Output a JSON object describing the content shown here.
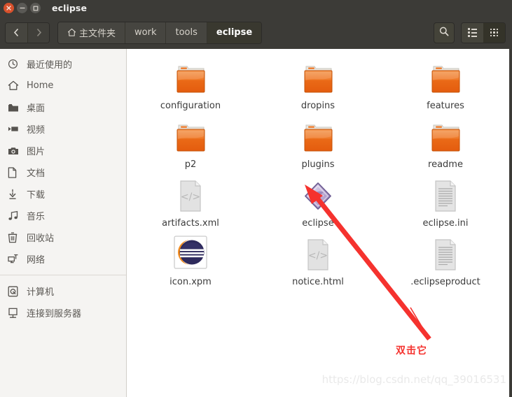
{
  "window": {
    "title": "eclipse",
    "controls": {
      "close": "close-button",
      "minimize": "minimize-button",
      "maximize": "maximize-button"
    }
  },
  "toolbar": {
    "back_label": "‹",
    "forward_label": "›",
    "search_label": "search-icon",
    "view_list_label": "list-view",
    "view_grid_label": "grid-view",
    "breadcrumbs": [
      {
        "label": "主文件夹",
        "icon": "home-icon",
        "active": false
      },
      {
        "label": "work",
        "icon": "",
        "active": false
      },
      {
        "label": "tools",
        "icon": "",
        "active": false
      },
      {
        "label": "eclipse",
        "icon": "",
        "active": true
      }
    ]
  },
  "sidebar": {
    "items": [
      {
        "label": "最近使用的",
        "icon": "clock-icon"
      },
      {
        "label": "Home",
        "icon": "home-icon"
      },
      {
        "label": "桌面",
        "icon": "folder-icon"
      },
      {
        "label": "视频",
        "icon": "video-icon"
      },
      {
        "label": "图片",
        "icon": "camera-icon"
      },
      {
        "label": "文档",
        "icon": "document-icon"
      },
      {
        "label": "下载",
        "icon": "download-icon"
      },
      {
        "label": "音乐",
        "icon": "music-icon"
      },
      {
        "label": "回收站",
        "icon": "trash-icon"
      },
      {
        "label": "网络",
        "icon": "network-icon"
      }
    ],
    "items_lower": [
      {
        "label": "计算机",
        "icon": "computer-icon"
      },
      {
        "label": "连接到服务器",
        "icon": "server-icon"
      }
    ]
  },
  "files": [
    {
      "name": "configuration",
      "type": "folder"
    },
    {
      "name": "dropins",
      "type": "folder"
    },
    {
      "name": "features",
      "type": "folder"
    },
    {
      "name": "p2",
      "type": "folder"
    },
    {
      "name": "plugins",
      "type": "folder"
    },
    {
      "name": "readme",
      "type": "folder"
    },
    {
      "name": "artifacts.xml",
      "type": "code"
    },
    {
      "name": "eclipse",
      "type": "eclipse-exec"
    },
    {
      "name": "eclipse.ini",
      "type": "text"
    },
    {
      "name": "icon.xpm",
      "type": "image-eclipse"
    },
    {
      "name": "notice.html",
      "type": "code"
    },
    {
      "name": ".eclipseproduct",
      "type": "text"
    }
  ],
  "annotation": {
    "text": "双击它",
    "color": "#f5322e"
  },
  "watermark": {
    "text": "https://blog.csdn.net/qq_39016531"
  },
  "colors": {
    "titlebar": "#3c3b37",
    "sidebar_bg": "#f5f4f2",
    "content_bg": "#ffffff",
    "folder": "#e8641d",
    "accent_close": "#d8512c",
    "annotation": "#f5322e"
  }
}
